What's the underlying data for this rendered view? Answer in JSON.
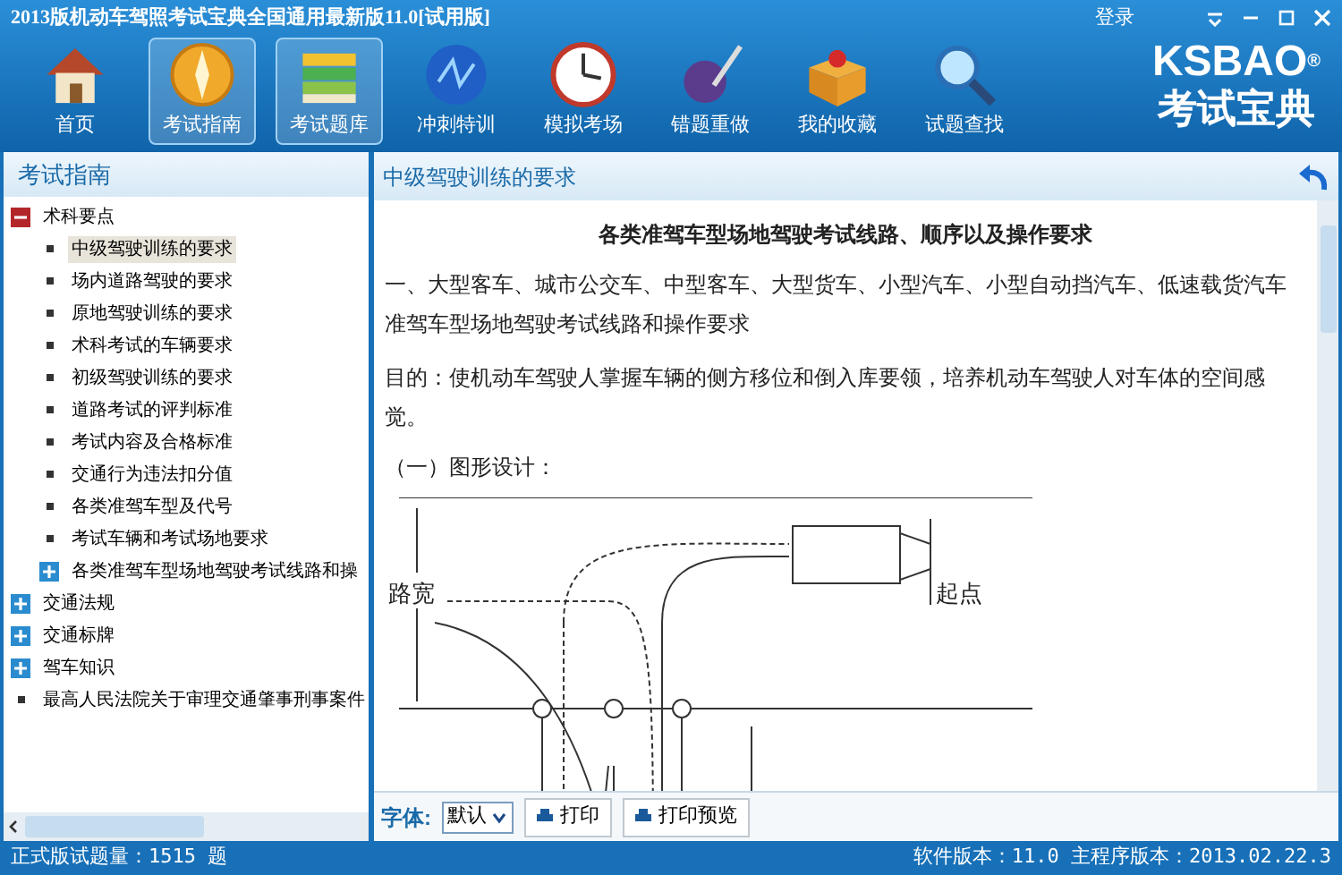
{
  "window": {
    "title": "2013版机动车驾照考试宝典全国通用最新版11.0[试用版]",
    "login": "登录"
  },
  "toolbar": [
    {
      "label": "首页",
      "kind": "home",
      "selected": false
    },
    {
      "label": "考试指南",
      "kind": "compass",
      "selected": true
    },
    {
      "label": "考试题库",
      "kind": "books",
      "selected": true
    },
    {
      "label": "冲刺特训",
      "kind": "globe",
      "selected": false
    },
    {
      "label": "模拟考场",
      "kind": "clock",
      "selected": false
    },
    {
      "label": "错题重做",
      "kind": "ink",
      "selected": false
    },
    {
      "label": "我的收藏",
      "kind": "box",
      "selected": false
    },
    {
      "label": "试题查找",
      "kind": "search",
      "selected": false
    }
  ],
  "logo": {
    "brand": "KSBAO",
    "mark": "®",
    "name": "考试宝典"
  },
  "sidebar": {
    "title": "考试指南",
    "items": [
      {
        "label": "术科要点",
        "expanded": true,
        "children": [
          {
            "label": "中级驾驶训练的要求",
            "selected": true
          },
          {
            "label": "场内道路驾驶的要求",
            "selected": false
          },
          {
            "label": "原地驾驶训练的要求",
            "selected": false
          },
          {
            "label": "术科考试的车辆要求",
            "selected": false
          },
          {
            "label": "初级驾驶训练的要求",
            "selected": false
          },
          {
            "label": "道路考试的评判标准",
            "selected": false
          },
          {
            "label": "考试内容及合格标准",
            "selected": false
          },
          {
            "label": "交通行为违法扣分值",
            "selected": false
          },
          {
            "label": "各类准驾车型及代号",
            "selected": false
          },
          {
            "label": "考试车辆和考试场地要求",
            "selected": false
          },
          {
            "label": "各类准驾车型场地驾驶考试线路和操",
            "expanded": false
          }
        ]
      },
      {
        "label": "交通法规",
        "expanded": false
      },
      {
        "label": "交通标牌",
        "expanded": false
      },
      {
        "label": "驾车知识",
        "expanded": false
      },
      {
        "label": "最高人民法院关于审理交通肇事刑事案件"
      }
    ]
  },
  "article": {
    "header": "中级驾驶训练的要求",
    "title": "各类准驾车型场地驾驶考试线路、顺序以及操作要求",
    "paragraphs": [
      "一、大型客车、城市公交车、中型客车、大型货车、小型汽车、小型自动挡汽车、低速载货汽车准驾车型场地驾驶考试线路和操作要求",
      "目的：使机动车驾驶人掌握车辆的侧方移位和倒入库要领，培养机动车驾驶人对车体的空间感觉。"
    ],
    "subheading": "（一）图形设计：",
    "diagram": {
      "road_width": "路宽",
      "start": "起点"
    }
  },
  "bottom_bar": {
    "font_label": "字体:",
    "font_value": "默认",
    "buttons": [
      "打印",
      "打印预览"
    ]
  },
  "status_bar": {
    "left": "正式版试题量：1515 题",
    "right": "软件版本：11.0 主程序版本：2013.02.22.3"
  }
}
